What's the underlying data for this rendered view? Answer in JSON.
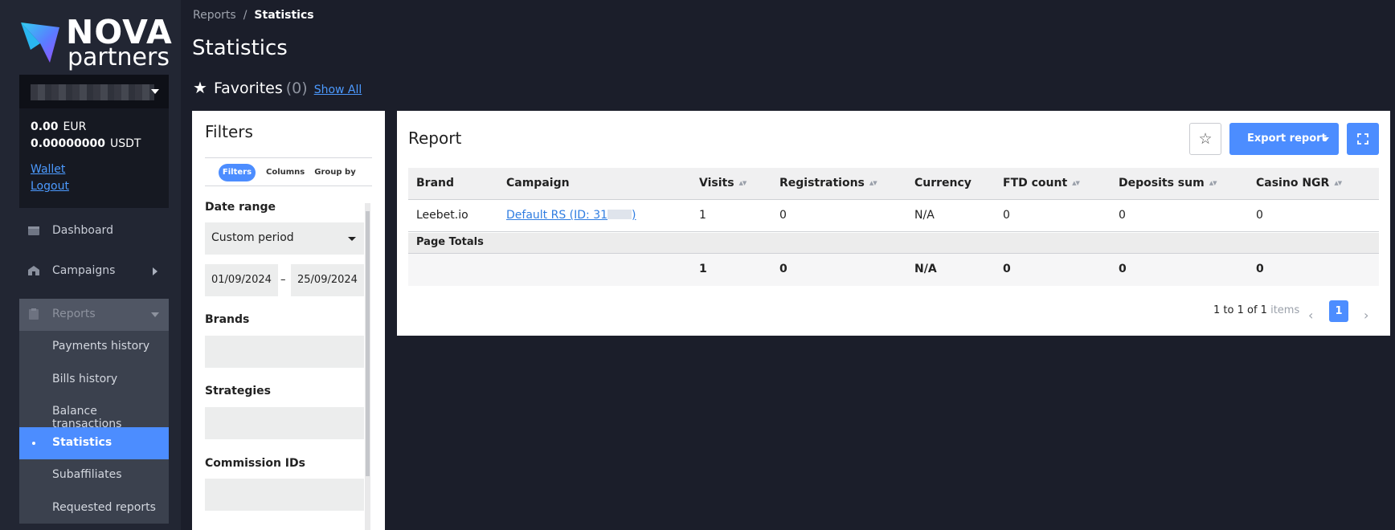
{
  "brand": {
    "name_top": "NOVA",
    "name_bottom": "partners"
  },
  "account": {
    "balances": [
      {
        "amount": "0.00",
        "currency": "EUR"
      },
      {
        "amount": "0.00000000",
        "currency": "USDT"
      }
    ],
    "wallet_link": "Wallet",
    "logout_link": "Logout"
  },
  "nav": {
    "dashboard": "Dashboard",
    "campaigns": "Campaigns",
    "reports": "Reports",
    "sub": [
      "Payments history",
      "Bills history",
      "Balance transactions",
      "Statistics",
      "Subaffiliates",
      "Requested reports"
    ]
  },
  "breadcrumb": {
    "parent": "Reports",
    "separator": "/",
    "current": "Statistics"
  },
  "page_title": "Statistics",
  "favorites": {
    "label": "Favorites",
    "count": "(0)",
    "show_all": "Show All"
  },
  "filters": {
    "title": "Filters",
    "tabs": [
      "Filters",
      "Columns",
      "Group by"
    ],
    "date_range_label": "Date range",
    "period_value": "Custom period",
    "date_from": "01/09/2024",
    "date_sep": "–",
    "date_to": "25/09/2024",
    "brands_label": "Brands",
    "strategies_label": "Strategies",
    "commission_ids_label": "Commission IDs"
  },
  "report": {
    "title": "Report",
    "export_label": "Export report",
    "columns": [
      "Brand",
      "Campaign",
      "Visits",
      "Registrations",
      "Currency",
      "FTD count",
      "Deposits sum",
      "Casino NGR"
    ],
    "row": {
      "brand": "Leebet.io",
      "campaign": "Default RS (ID: 31",
      "campaign_end": ")",
      "visits": "1",
      "registrations": "0",
      "currency": "N/A",
      "ftd_count": "0",
      "deposits_sum": "0",
      "casino_ngr": "0"
    },
    "page_totals_label": "Page Totals",
    "totals": {
      "visits": "1",
      "registrations": "0",
      "currency": "N/A",
      "ftd_count": "0",
      "deposits_sum": "0",
      "casino_ngr": "0"
    },
    "pagination": {
      "range": "1 to 1 of 1",
      "items_word": "items",
      "current_page": "1"
    }
  },
  "colors": {
    "accent": "#4c8dff",
    "background": "#1b1e2a",
    "sidebar": "#222633",
    "link": "#4c9aff"
  },
  "icons": [
    "logo-arrow-icon",
    "caret-down-icon",
    "dashboard-icon",
    "campaigns-icon",
    "reports-icon",
    "chevron-right-icon",
    "star-icon",
    "fullscreen-icon",
    "chevron-left-icon",
    "sort-icon"
  ]
}
